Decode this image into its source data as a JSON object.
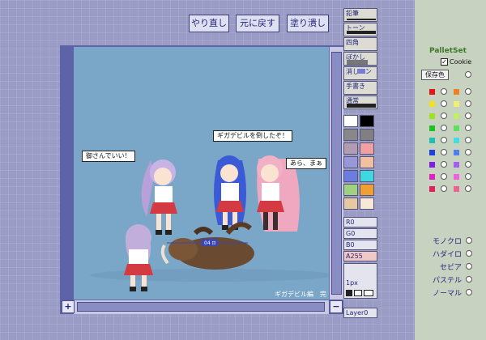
{
  "toolbar": {
    "redo": "やり直し",
    "undo": "元に戻す",
    "fill": "塗り潰し"
  },
  "tools": {
    "pencil": "鉛筆",
    "tone": "トーン",
    "rect": "四角",
    "blur": "ぼかし",
    "eraser": "消しペン",
    "mask": "手書き",
    "normal": "通常"
  },
  "swatches": [
    "#ffffff",
    "#000000",
    "#888888",
    "#808080",
    "#b49cb0",
    "#f0a0a0",
    "#9898d8",
    "#f0c0a0",
    "#6c7ce0",
    "#40d8e0",
    "#a0d080",
    "#f0a030",
    "#e8c8a0",
    "#f8e8d8"
  ],
  "sliders": {
    "r": "R0",
    "g": "G0",
    "b": "B0",
    "a": "A255"
  },
  "brush_size": "1px",
  "layer": "Layer0",
  "canvas": {
    "bubble_left": "御さんでいい！",
    "bubble_top": "ギガデビルを倒したぞ！",
    "bubble_right": "あら、まぁ",
    "credit": "ギガデビル編　完",
    "badge": "04 ⊡"
  },
  "palette": {
    "title": "PalletSet",
    "cookie_label": "Cookie",
    "save_label": "保存色",
    "row_colors": [
      [
        "#e01818",
        "#f08020"
      ],
      [
        "#f0e020",
        "#f0f070"
      ],
      [
        "#a0e020",
        "#c0f060"
      ],
      [
        "#20c020",
        "#60e060"
      ],
      [
        "#20c0b0",
        "#40e0e0"
      ],
      [
        "#2040e0",
        "#5080f0"
      ],
      [
        "#8020e0",
        "#a060f0"
      ],
      [
        "#e020c0",
        "#f060e0"
      ],
      [
        "#e02060",
        "#f06090"
      ]
    ]
  },
  "modes": [
    "モノクロ",
    "ハダイロ",
    "セピア",
    "パステル",
    "ノーマル"
  ]
}
